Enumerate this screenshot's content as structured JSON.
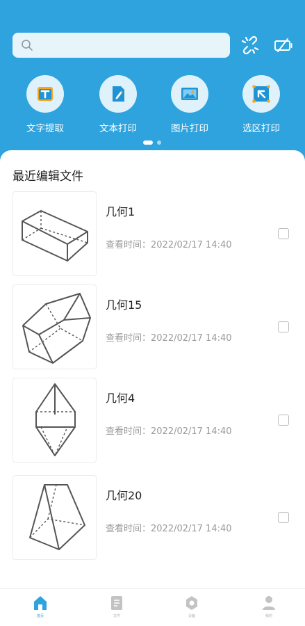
{
  "header": {
    "search": {
      "value": "",
      "placeholder": ""
    },
    "icons": [
      "unlink-icon",
      "battery-slash-icon"
    ]
  },
  "actions": [
    {
      "label": "文字提取",
      "icon": "text-extract-icon"
    },
    {
      "label": "文本打印",
      "icon": "text-print-icon"
    },
    {
      "label": "图片打印",
      "icon": "image-print-icon"
    },
    {
      "label": "选区打印",
      "icon": "region-print-icon"
    }
  ],
  "carousel": {
    "current_page": 1,
    "total_pages": 2
  },
  "recent": {
    "title": "最近编辑文件",
    "files": [
      {
        "name": "几何1",
        "time": "查看时间：2022/02/17  14:40",
        "thumbnail": "cuboid"
      },
      {
        "name": "几何15",
        "time": "查看时间：2022/02/17  14:40",
        "thumbnail": "hexagonal-prism"
      },
      {
        "name": "几何4",
        "time": "查看时间：2022/02/17  14:40",
        "thumbnail": "bipyramid"
      },
      {
        "name": "几何20",
        "time": "查看时间：2022/02/17  14:40",
        "thumbnail": "frustum"
      }
    ]
  },
  "tabbar": {
    "tabs": [
      {
        "label": "首页",
        "icon": "home-icon",
        "active": true
      },
      {
        "label": "文件",
        "icon": "file-icon",
        "active": false
      },
      {
        "label": "设备",
        "icon": "device-settings-icon",
        "active": false
      },
      {
        "label": "我的",
        "icon": "user-icon",
        "active": false
      }
    ]
  },
  "colors": {
    "primary": "#2ea3dd",
    "icon_bg": "#dff2fb",
    "muted_text": "#9a9a9a"
  }
}
